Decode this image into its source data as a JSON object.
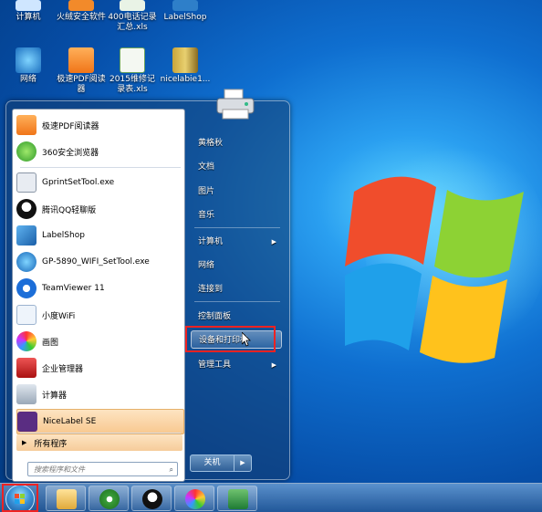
{
  "desktop": {
    "icons": [
      {
        "label": "计算机",
        "icon": "computer-icon"
      },
      {
        "label": "火绒安全软件",
        "icon": "shield-app-icon"
      },
      {
        "label": "400电话记录汇总.xls",
        "icon": "excel-file-icon"
      },
      {
        "label": "LabelShop",
        "icon": "labelshop-icon"
      },
      {
        "label": "网络",
        "icon": "network-icon"
      },
      {
        "label": "极速PDF阅读器",
        "icon": "pdf-reader-icon"
      },
      {
        "label": "2015维修记录表.xls",
        "icon": "excel-file-icon"
      },
      {
        "label": "nicelabie1...",
        "icon": "archive-icon"
      }
    ]
  },
  "start_menu": {
    "programs": [
      {
        "label": "极速PDF阅读器",
        "icon": "pdf-reader-icon"
      },
      {
        "label": "360安全浏览器",
        "icon": "browser-360-icon"
      },
      {
        "label": "GprintSetTool.exe",
        "icon": "usb-icon"
      },
      {
        "label": "腾讯QQ轻聊版",
        "icon": "qq-icon"
      },
      {
        "label": "LabelShop",
        "icon": "labelshop-icon"
      },
      {
        "label": "GP-5890_WIFI_SetTool.exe",
        "icon": "globe-icon"
      },
      {
        "label": "TeamViewer 11",
        "icon": "teamviewer-icon"
      },
      {
        "label": "小度WiFi",
        "icon": "wifi-icon"
      },
      {
        "label": "画图",
        "icon": "paint-icon"
      },
      {
        "label": "企业管理器",
        "icon": "toolbox-icon"
      },
      {
        "label": "计算器",
        "icon": "calculator-icon"
      },
      {
        "label": "NiceLabel SE",
        "icon": "nicelabel-icon"
      }
    ],
    "all_programs": "所有程序",
    "search_placeholder": "搜索程序和文件",
    "right_items": [
      {
        "label": "黄格秋"
      },
      {
        "label": "文档"
      },
      {
        "label": "图片"
      },
      {
        "label": "音乐"
      },
      {
        "label": "计算机",
        "arrow": "▶"
      },
      {
        "label": "网络"
      },
      {
        "label": "连接到"
      },
      {
        "label": "控制面板"
      },
      {
        "label": "设备和打印机"
      },
      {
        "label": "管理工具",
        "arrow": "▶"
      }
    ],
    "shutdown_label": "关机",
    "shutdown_arrow": "▶"
  },
  "taskbar": {
    "pinned": [
      {
        "icon": "windows-explorer-icon"
      },
      {
        "icon": "ie-browser-icon"
      },
      {
        "icon": "qq-icon"
      },
      {
        "icon": "paint-icon"
      },
      {
        "icon": "excel-icon"
      }
    ]
  },
  "colors": {
    "highlight_box": "#e22222",
    "menu_hover": "#fde4c2"
  }
}
